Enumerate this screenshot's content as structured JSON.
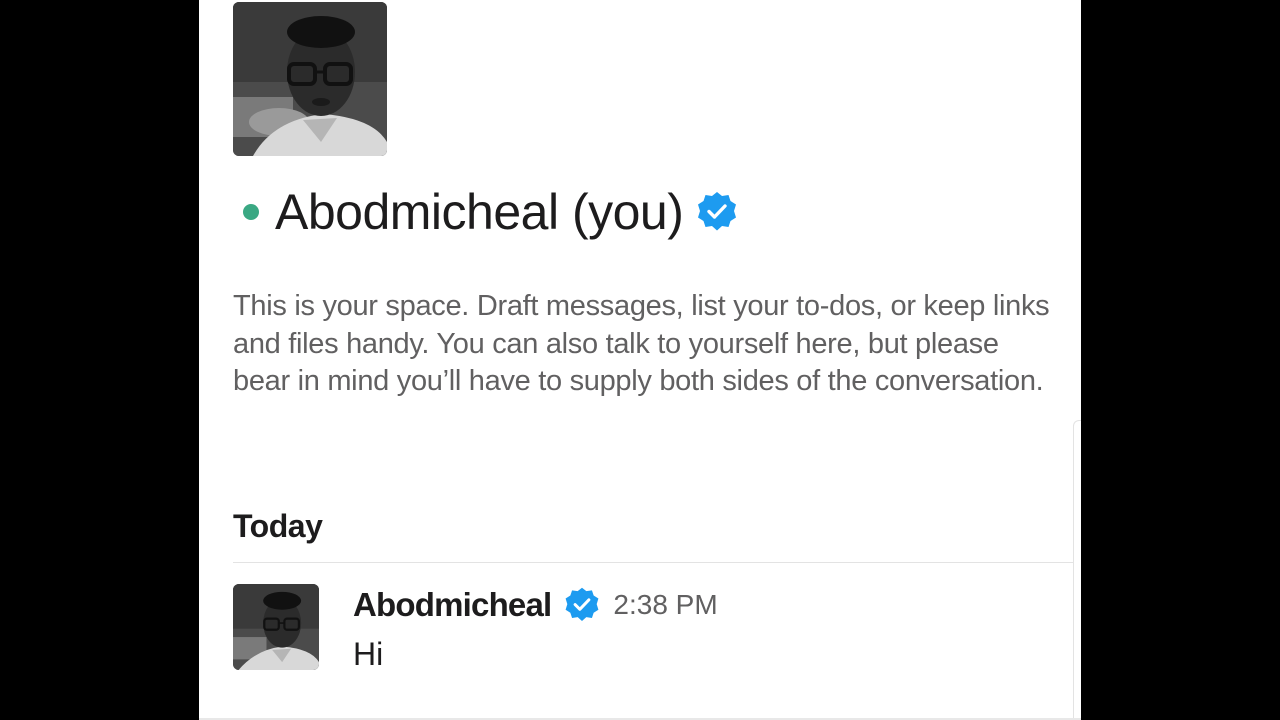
{
  "profile": {
    "name": "Abodmicheal (you)",
    "status": "online",
    "verified": true,
    "avatar_icon": "user-photo",
    "intro": "This is your space. Draft messages, list your to-dos, or keep links and files handy. You can also talk to yourself here, but please bear in mind you’ll have to supply both sides of the conversation."
  },
  "feed": {
    "day_label": "Today",
    "messages": [
      {
        "sender": "Abodmicheal",
        "verified": true,
        "time": "2:38 PM",
        "text": "Hi"
      }
    ]
  },
  "colors": {
    "presence": "#3aa883",
    "verified": "#1d9bf0",
    "text": "#1d1c1d",
    "muted": "#616061"
  }
}
